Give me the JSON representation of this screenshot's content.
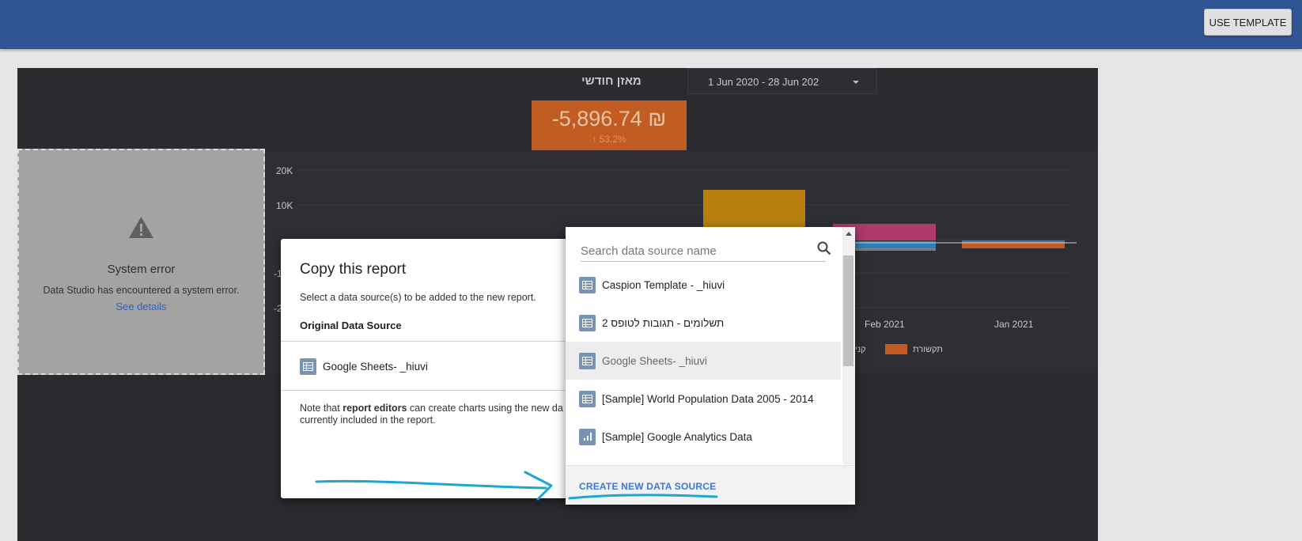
{
  "header": {
    "use_template_label": "USE TEMPLATE"
  },
  "report": {
    "title": "מאזן חודשי",
    "date_range": "1 Jun 2020 - 28 Jun 202",
    "scorecard": {
      "value": "-5,896.74 ₪",
      "delta": "↑ 53.2%"
    }
  },
  "chart_data": {
    "type": "bar",
    "y_ticks": [
      "20K",
      "10K",
      "-1",
      "-2"
    ],
    "x_ticks": [
      "Feb 2021",
      "Jan 2021"
    ],
    "legend": [
      "קני",
      "תקשורת"
    ],
    "colors": {
      "gold": "#b7800e",
      "pink": "#b03a6a",
      "blue": "#2d7fb8",
      "orange": "#c15d23",
      "gray": "#7c7d82"
    }
  },
  "error_panel": {
    "title": "System error",
    "message": "Data Studio has encountered a system error.",
    "link": "See details"
  },
  "copy_dialog": {
    "title": "Copy this report",
    "subtitle": "Select a data source(s) to be added to the new report.",
    "original_header": "Original Data Source",
    "original_source": "Google Sheets- _hiuvi",
    "note_prefix": "Note that ",
    "note_bold": "report editors",
    "note_suffix": " can create charts using the new da",
    "note_line2": "currently included in the report."
  },
  "data_source_picker": {
    "search_placeholder": "Search data source name",
    "items": [
      {
        "label": "Caspion Template - _hiuvi",
        "icon": "sheet-icon"
      },
      {
        "label": "תשלומים - תגובות לטופס 2",
        "icon": "sheet-icon"
      },
      {
        "label": "Google Sheets- _hiuvi",
        "icon": "sheet-icon"
      },
      {
        "label": "[Sample] World Population Data 2005 - 2014",
        "icon": "sheet-icon"
      },
      {
        "label": "[Sample] Google Analytics Data",
        "icon": "analytics-icon"
      }
    ],
    "create_label": "CREATE NEW DATA SOURCE"
  },
  "theme": {
    "header_blue": "#2f5594",
    "canvas_dark": "#2a2b2f",
    "annotation_cyan": "#1ba7d2",
    "link_blue": "#3b78d8"
  }
}
